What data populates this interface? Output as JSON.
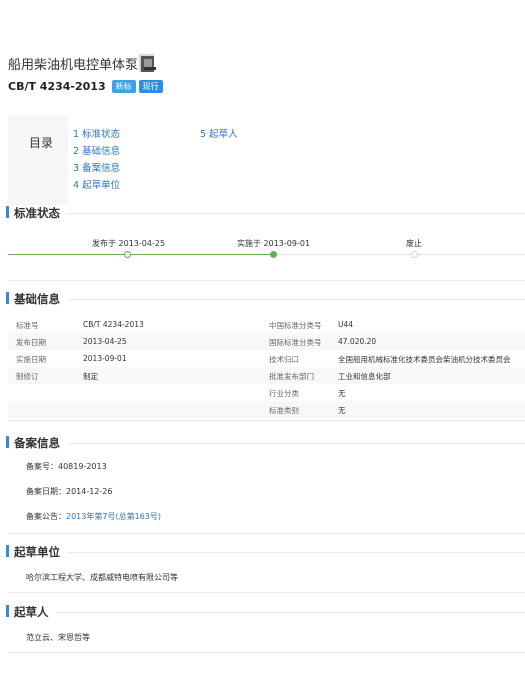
{
  "header": {
    "title": "船用柴油机电控单体泵",
    "code": "CB/T 4234-2013",
    "badges": [
      "新标",
      "现行"
    ]
  },
  "toc": {
    "label": "目录",
    "items": [
      "1 标准状态",
      "2 基础信息",
      "3 备案信息",
      "4 起草单位",
      "5 起草人"
    ]
  },
  "sections": {
    "status": "标准状态",
    "basic": "基础信息",
    "record": "备案信息",
    "drafters_org": "起草单位",
    "drafters": "起草人"
  },
  "timeline": {
    "published": "发布于 2013-04-25",
    "implemented": "实施于 2013-09-01",
    "abolished": "废止"
  },
  "basic_info": {
    "left": [
      {
        "label": "标准号",
        "value": "CB/T 4234-2013"
      },
      {
        "label": "发布日期",
        "value": "2013-04-25"
      },
      {
        "label": "实施日期",
        "value": "2013-09-01"
      },
      {
        "label": "制修订",
        "value": "制定"
      }
    ],
    "right": [
      {
        "label": "中国标准分类号",
        "value": "U44"
      },
      {
        "label": "国际标准分类号",
        "value": "47.020.20"
      },
      {
        "label": "技术归口",
        "value": "全国船用机械标准化技术委员会柴油机分技术委员会"
      },
      {
        "label": "批准发布部门",
        "value": "工业和信息化部"
      },
      {
        "label": "行业分类",
        "value": "无"
      },
      {
        "label": "标准类别",
        "value": "无"
      }
    ]
  },
  "record": {
    "number": "备案号：40819-2013",
    "date": "备案日期：2014-12-26",
    "notice_label": "备案公告：",
    "notice_link": "2013年第7号(总第163号)"
  },
  "drafting_org": "哈尔滨工程大学、成都威特电喷有限公司等",
  "drafters": "范立云、宋恩哲等",
  "colors": {
    "accent": "#3a88d8",
    "link": "#2f74c0",
    "timeline_done": "#6aaa5a"
  }
}
